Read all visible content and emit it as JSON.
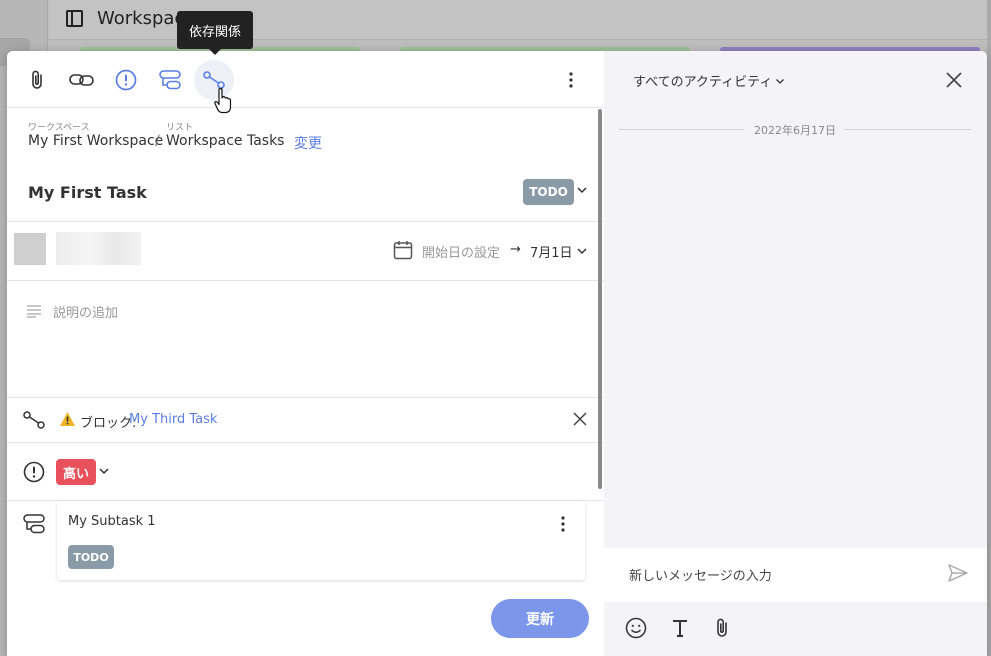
{
  "background": {
    "workspace_title": "Workspace"
  },
  "tooltip": {
    "text": "依存関係"
  },
  "toolbar": {
    "icons": [
      "attachment-icon",
      "link-icon",
      "priority-icon",
      "subtask-icon",
      "dependency-icon",
      "more-icon"
    ]
  },
  "breadcrumb": {
    "workspace_caption": "ワークスペース",
    "workspace_name": "My First Workspace",
    "separator": "/",
    "list_caption": "リスト",
    "list_name": "Workspace Tasks",
    "change_label": "変更"
  },
  "task": {
    "title": "My First Task",
    "status": "TODO",
    "start_date_placeholder": "開始日の設定",
    "arrow": "→",
    "due_date": "7月1日",
    "description_placeholder": "説明の追加"
  },
  "dependency": {
    "label": "ブロック:",
    "task_name": "My Third Task"
  },
  "priority": {
    "label": "高い"
  },
  "subtask": {
    "name": "My Subtask 1",
    "status": "TODO"
  },
  "update_button": "更新",
  "activity": {
    "filter_label": "すべてのアクティビティ",
    "date_separator": "2022年6月17日",
    "message_placeholder": "新しいメッセージの入力"
  },
  "colors": {
    "accent": "#5b7ee5",
    "status_todo": "#8a9aa6",
    "priority_high": "#e8505b",
    "update_button": "#7c97ea"
  }
}
